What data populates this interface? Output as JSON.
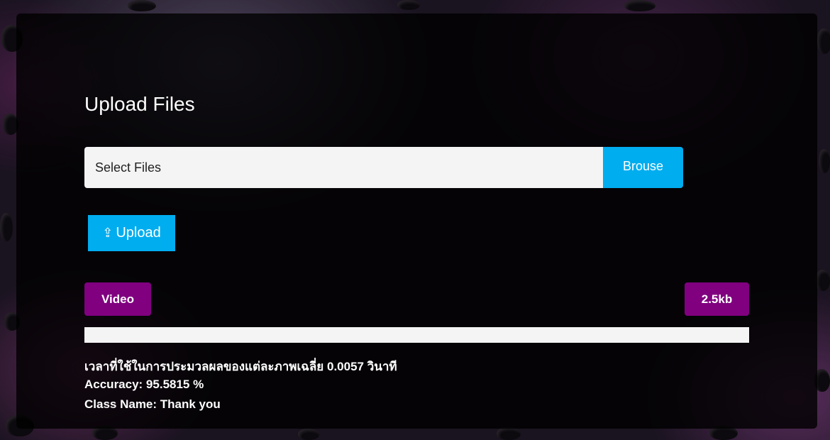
{
  "upload": {
    "title": "Upload Files",
    "file_input_placeholder": "Select Files",
    "browse_label": "Brouse",
    "upload_icon": "⇪",
    "upload_label": "Upload",
    "file_type_badge": "Video",
    "file_size_badge": "2.5kb",
    "progress_fraction": 1.0
  },
  "results": {
    "processing_time": "เวลาที่ใช้ในการประมวลผลของแต่ละภาพเฉลี่ย 0.0057 วินาที",
    "accuracy": "Accuracy: 95.5815 %",
    "class_name": "Class Name: Thank you"
  },
  "colors": {
    "accent_blue": "#00adef",
    "badge_purple": "#800080",
    "panel_bg": "rgba(0,0,0,0.8)"
  }
}
